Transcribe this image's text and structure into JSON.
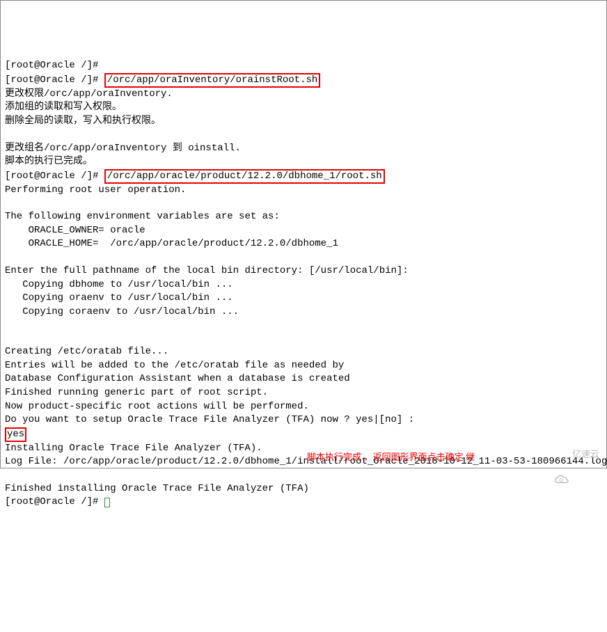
{
  "term": {
    "lines": [
      {
        "prompt": "[root@Oracle /]# ",
        "cmd": "",
        "highlight": false
      },
      {
        "prompt": "[root@Oracle /]# ",
        "cmd": "/orc/app/oraInventory/orainstRoot.sh",
        "highlight": true
      },
      {
        "text": "更改权限/orc/app/oraInventory."
      },
      {
        "text": "添加组的读取和写入权限。"
      },
      {
        "text": "删除全局的读取，写入和执行权限。"
      },
      {
        "text": ""
      },
      {
        "text": "更改组名/orc/app/oraInventory 到 oinstall."
      },
      {
        "text": "脚本的执行已完成。"
      },
      {
        "prompt": "[root@Oracle /]# ",
        "cmd": "/orc/app/oracle/product/12.2.0/dbhome_1/root.sh",
        "highlight": true
      },
      {
        "text": "Performing root user operation."
      },
      {
        "text": ""
      },
      {
        "text": "The following environment variables are set as:"
      },
      {
        "text": "    ORACLE_OWNER= oracle"
      },
      {
        "text": "    ORACLE_HOME=  /orc/app/oracle/product/12.2.0/dbhome_1"
      },
      {
        "text": ""
      },
      {
        "text": "Enter the full pathname of the local bin directory: [/usr/local/bin]:"
      },
      {
        "text": "   Copying dbhome to /usr/local/bin ..."
      },
      {
        "text": "   Copying oraenv to /usr/local/bin ..."
      },
      {
        "text": "   Copying coraenv to /usr/local/bin ..."
      },
      {
        "text": ""
      },
      {
        "text": ""
      },
      {
        "text": "Creating /etc/oratab file..."
      },
      {
        "text": "Entries will be added to the /etc/oratab file as needed by"
      },
      {
        "text": "Database Configuration Assistant when a database is created"
      },
      {
        "text": "Finished running generic part of root script."
      },
      {
        "text": "Now product-specific root actions will be performed."
      },
      {
        "text": "Do you want to setup Oracle Trace File Analyzer (TFA) now ? yes|[no] :"
      },
      {
        "text": "yes",
        "highlight_small": true
      },
      {
        "text": "Installing Oracle Trace File Analyzer (TFA)."
      },
      {
        "text": "Log File: /orc/app/oracle/product/12.2.0/dbhome_1/install/root_Oracle_2018-10-12_11-03-53-180966144.log",
        "wrap": true
      },
      {
        "text": "Finished installing Oracle Trace File Analyzer (TFA)"
      },
      {
        "prompt": "[root@Oracle /]# ",
        "cursor": true
      }
    ],
    "footer_note": "脚本执行完成 ，返回图形界面点击确定 继",
    "watermark": "亿速云"
  }
}
